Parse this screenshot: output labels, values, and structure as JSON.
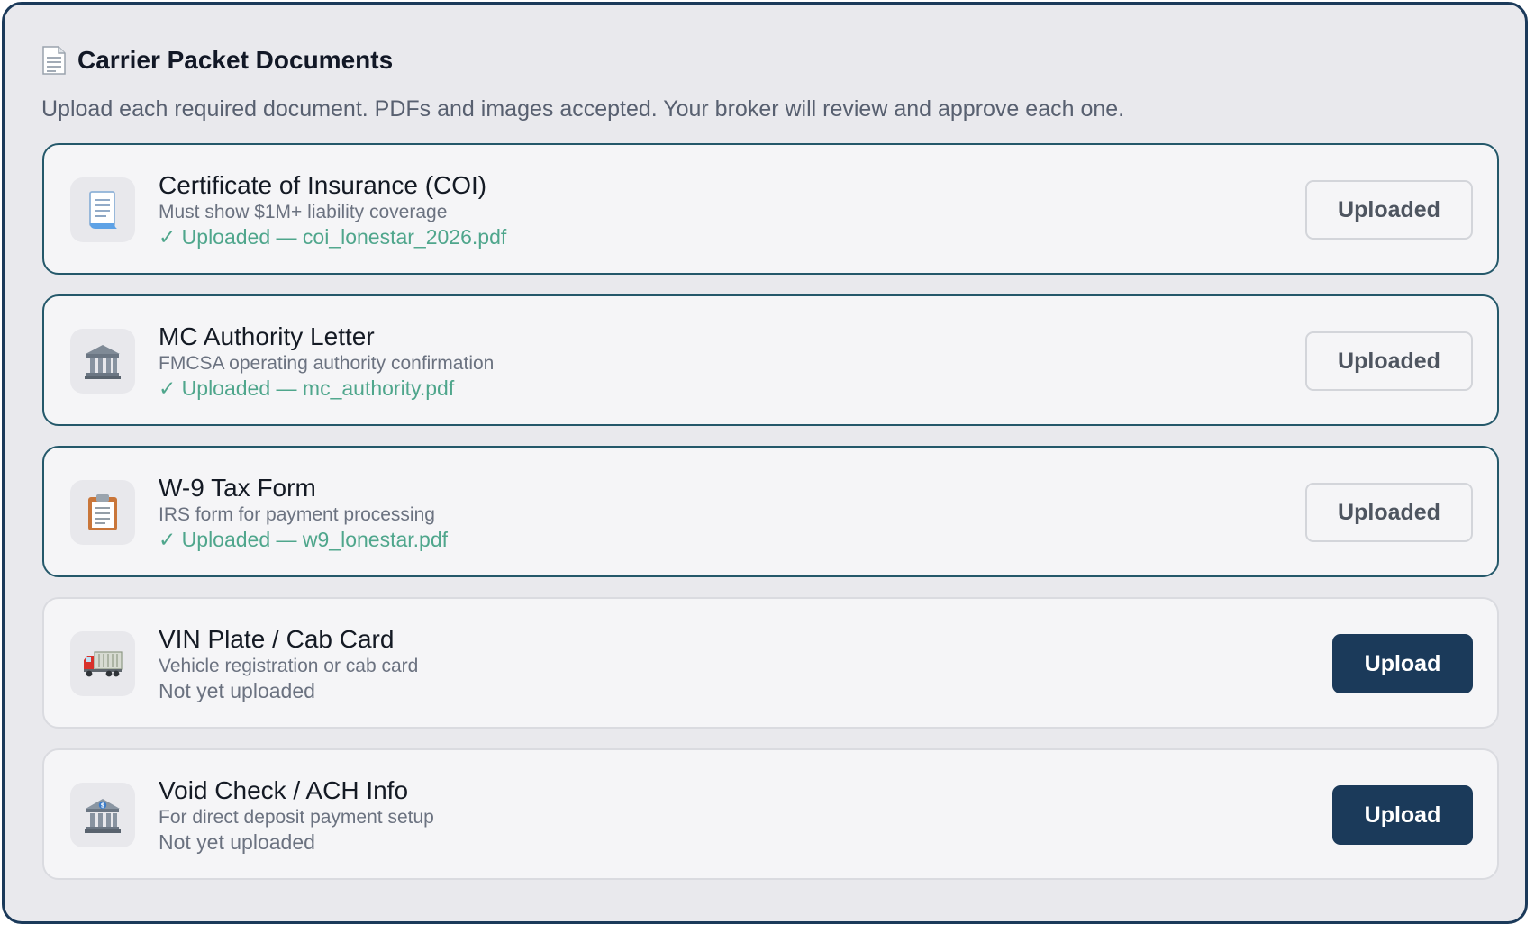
{
  "header": {
    "title": "Carrier Packet Documents",
    "title_icon": "page-icon",
    "subtitle": "Upload each required document. PDFs and images accepted. Your broker will review and approve each one."
  },
  "colors": {
    "accent": "#1b3a5a",
    "success": "#4fa68c",
    "panel_bg": "#e9e9ed"
  },
  "documents": [
    {
      "name": "Certificate of Insurance (COI)",
      "description": "Must show $1M+ liability coverage",
      "status": "✓ Uploaded — coi_lonestar_2026.pdf",
      "button": "Uploaded",
      "uploaded": true,
      "icon": "receipt-icon"
    },
    {
      "name": "MC Authority Letter",
      "description": "FMCSA operating authority confirmation",
      "status": "✓ Uploaded — mc_authority.pdf",
      "button": "Uploaded",
      "uploaded": true,
      "icon": "government-building-icon"
    },
    {
      "name": "W-9 Tax Form",
      "description": "IRS form for payment processing",
      "status": "✓ Uploaded — w9_lonestar.pdf",
      "button": "Uploaded",
      "uploaded": true,
      "icon": "clipboard-icon"
    },
    {
      "name": "VIN Plate / Cab Card",
      "description": "Vehicle registration or cab card",
      "status": "Not yet uploaded",
      "button": "Upload",
      "uploaded": false,
      "icon": "truck-icon"
    },
    {
      "name": "Void Check / ACH Info",
      "description": "For direct deposit payment setup",
      "status": "Not yet uploaded",
      "button": "Upload",
      "uploaded": false,
      "icon": "bank-icon"
    }
  ]
}
